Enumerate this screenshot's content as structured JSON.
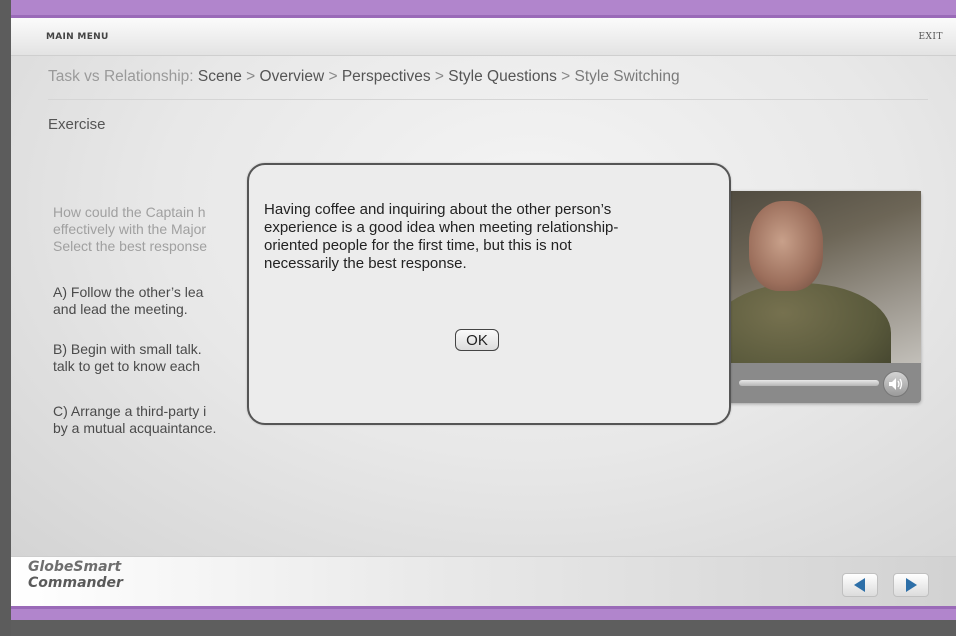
{
  "header": {
    "main_menu": "MAIN MENU",
    "exit": "EXIT"
  },
  "breadcrumb": {
    "prefix": "Task vs Relationship:",
    "items": [
      "Scene",
      "Overview",
      "Perspectives",
      "Style Questions",
      "Style Switching"
    ],
    "separator": ">"
  },
  "section": {
    "title": "Exercise"
  },
  "question": {
    "lines": [
      "How could the Captain h",
      "effectively with the Major",
      "Select the best response"
    ]
  },
  "options": [
    {
      "lines": [
        "A) Follow the other’s lea",
        "and lead the meeting."
      ]
    },
    {
      "lines": [
        "B) Begin with small talk.",
        "talk to get to know each"
      ]
    },
    {
      "lines": [
        "C) Arrange a third-party i",
        "by a mutual acquaintance."
      ]
    }
  ],
  "dialog": {
    "lines": [
      "Having coffee and inquiring about the other person’s",
      "experience is a good idea when meeting relationship-",
      "oriented people for the first time, but this is not",
      "necessarily the best response."
    ],
    "ok_label": "OK"
  },
  "video": {
    "volume_icon": "speaker-icon"
  },
  "footer": {
    "logo_line1": "GlobeSmart",
    "logo_line2": "Commander",
    "prev_icon": "arrow-left-icon",
    "next_icon": "arrow-right-icon"
  },
  "colors": {
    "accent_purple": "#b185cc",
    "nav_arrow_blue": "#2d6fa8"
  }
}
